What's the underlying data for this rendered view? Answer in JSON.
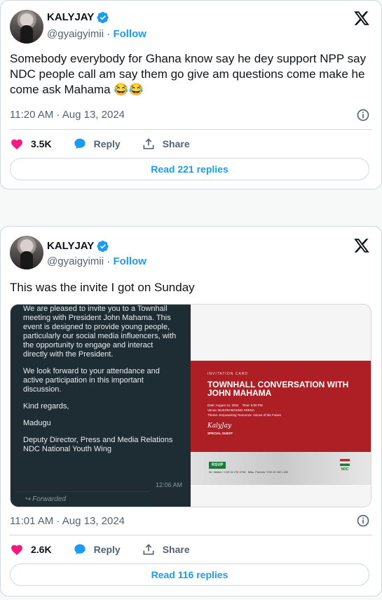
{
  "tweets": [
    {
      "author": {
        "name": "KALYJAY",
        "handle": "@gyaigyimii",
        "follow_label": "Follow",
        "separator": " · "
      },
      "text": "Somebody everybody for Ghana know say he dey support NPP say NDC people call am say them go give am questions come make he come ask Mahama 😂😂",
      "timestamp": "11:20 AM · Aug 13, 2024",
      "likes": "3.5K",
      "reply_label": "Reply",
      "share_label": "Share",
      "read_replies": "Read 221 replies"
    },
    {
      "author": {
        "name": "KALYJAY",
        "handle": "@gyaigyimii",
        "follow_label": "Follow",
        "separator": " · "
      },
      "text": "This was the invite I got on Sunday",
      "timestamp": "11:01 AM · Aug 13, 2024",
      "likes": "2.6K",
      "reply_label": "Reply",
      "share_label": "Share",
      "read_replies": "Read 116 replies"
    }
  ],
  "media": {
    "chat_paragraphs": [
      "We are pleased to invite you to a Townhall meeting with President John Mahama. This event is designed to provide young people, particularly our social media influencers, with the opportunity to engage and interact directly with the President.",
      "We look forward to your attendance and active participation in this important discussion.",
      "Kind regards,",
      "Madugu",
      "Deputy Director, Press and Media Relations NDC National Youth Wing"
    ],
    "chat_time": "12:06 AM",
    "forwarded_label": "Forwarded",
    "invite": {
      "kicker": "INVITATION CARD",
      "title": "TOWNHALL CONVERSATION WITH JOHN MAHAMA",
      "date": "Date: August 12, 2024",
      "time": "Time: 6:00 PM",
      "venue": "Venue: BUKOM BOXING ARENA",
      "theme": "Theme: Empowering Tomorrow: Voices of the Future",
      "signature": "KalyJay",
      "guest": "SPECIAL GUEST",
      "rsvp": "RSVP",
      "contact1": "Mr. Walker +233 24 276 3736",
      "contact2": "Miss. Pamela +233 20 932 1430",
      "party": "NDC"
    }
  },
  "colors": {
    "like": "#f91880",
    "accent": "#1d9bf0",
    "verified": "#1d9bf0"
  },
  "icons": [
    "heart-icon",
    "reply-bubble-icon",
    "share-icon",
    "info-icon",
    "x-logo-icon",
    "verified-badge-icon"
  ]
}
